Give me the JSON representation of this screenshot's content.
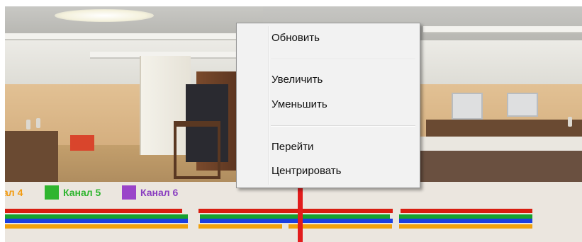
{
  "legend": {
    "items": [
      {
        "label": "ал 4",
        "color": "#f29b11"
      },
      {
        "label": "Канал 5",
        "color": "#2fb52f"
      },
      {
        "label": "Канал 6",
        "color": "#9a45c9"
      }
    ]
  },
  "timeline": {
    "playhead_color": "#e21c1c",
    "series_colors": {
      "red": "#d81d10",
      "green": "#16a12f",
      "blue": "#1b3fe0",
      "orange": "#f0a10c"
    }
  },
  "context_menu": {
    "items": [
      {
        "label": "Обновить"
      },
      {
        "label": "Увеличить"
      },
      {
        "label": "Уменьшить"
      },
      {
        "label": "Перейти"
      },
      {
        "label": "Центрировать"
      }
    ]
  }
}
